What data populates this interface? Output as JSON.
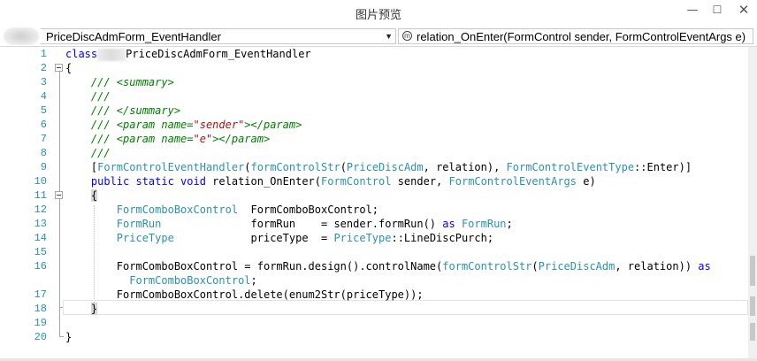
{
  "window": {
    "title": "图片预览",
    "minimize_glyph": "—",
    "maximize_glyph": "☐",
    "close_glyph": "✕"
  },
  "navbar": {
    "type_combo": {
      "value": "PriceDiscAdmForm_EventHandler",
      "arrow": "▼"
    },
    "method_combo": {
      "value": "relation_OnEnter(FormControl sender, FormControlEventArgs e)",
      "icon": "method-icon"
    }
  },
  "editor": {
    "line_numbers": [
      "1",
      "2",
      "3",
      "4",
      "5",
      "6",
      "7",
      "8",
      "9",
      "10",
      "11",
      "12",
      "13",
      "14",
      "15",
      "16",
      "",
      "17",
      "18",
      "19",
      "20"
    ],
    "lines": [
      [
        {
          "t": "kw",
          "v": "class"
        },
        {
          "t": "redacted",
          "v": ""
        },
        {
          "t": "plain",
          "v": "PriceDiscAdmForm_EventHandler"
        }
      ],
      [
        {
          "t": "plain",
          "v": "{"
        }
      ],
      [
        {
          "t": "plain",
          "v": "    "
        },
        {
          "t": "cm",
          "v": "/// <summary>"
        }
      ],
      [
        {
          "t": "plain",
          "v": "    "
        },
        {
          "t": "cm",
          "v": "///"
        }
      ],
      [
        {
          "t": "plain",
          "v": "    "
        },
        {
          "t": "cm",
          "v": "/// </summary>"
        }
      ],
      [
        {
          "t": "plain",
          "v": "    "
        },
        {
          "t": "cm",
          "v": "/// <param name="
        },
        {
          "t": "cms",
          "v": "\"sender\""
        },
        {
          "t": "cm",
          "v": "></param>"
        }
      ],
      [
        {
          "t": "plain",
          "v": "    "
        },
        {
          "t": "cm",
          "v": "/// <param name="
        },
        {
          "t": "cms",
          "v": "\"e\""
        },
        {
          "t": "cm",
          "v": "></param>"
        }
      ],
      [
        {
          "t": "plain",
          "v": "    "
        },
        {
          "t": "cm",
          "v": "///"
        }
      ],
      [
        {
          "t": "plain",
          "v": "    ["
        },
        {
          "t": "ty",
          "v": "FormControlEventHandler"
        },
        {
          "t": "plain",
          "v": "("
        },
        {
          "t": "ty",
          "v": "formControlStr"
        },
        {
          "t": "plain",
          "v": "("
        },
        {
          "t": "ty",
          "v": "PriceDiscAdm"
        },
        {
          "t": "plain",
          "v": ", relation), "
        },
        {
          "t": "ty",
          "v": "FormControlEventType"
        },
        {
          "t": "plain",
          "v": "::Enter)]"
        }
      ],
      [
        {
          "t": "plain",
          "v": "    "
        },
        {
          "t": "kw",
          "v": "public static void"
        },
        {
          "t": "plain",
          "v": " relation_OnEnter("
        },
        {
          "t": "ty",
          "v": "FormControl"
        },
        {
          "t": "plain",
          "v": " sender, "
        },
        {
          "t": "ty",
          "v": "FormControlEventArgs"
        },
        {
          "t": "plain",
          "v": " e)"
        }
      ],
      [
        {
          "t": "plain",
          "v": "    "
        },
        {
          "t": "brace",
          "v": "{"
        }
      ],
      [
        {
          "t": "plain",
          "v": "        "
        },
        {
          "t": "ty",
          "v": "FormComboBoxControl"
        },
        {
          "t": "plain",
          "v": "  FormComboBoxControl;"
        }
      ],
      [
        {
          "t": "plain",
          "v": "        "
        },
        {
          "t": "ty",
          "v": "FormRun"
        },
        {
          "t": "plain",
          "v": "              formRun    = sender.formRun() "
        },
        {
          "t": "kw",
          "v": "as"
        },
        {
          "t": "plain",
          "v": " "
        },
        {
          "t": "ty",
          "v": "FormRun"
        },
        {
          "t": "plain",
          "v": ";"
        }
      ],
      [
        {
          "t": "plain",
          "v": "        "
        },
        {
          "t": "ty",
          "v": "PriceType"
        },
        {
          "t": "plain",
          "v": "            priceType  = "
        },
        {
          "t": "ty",
          "v": "PriceType"
        },
        {
          "t": "plain",
          "v": "::LineDiscPurch;"
        }
      ],
      [
        {
          "t": "plain",
          "v": ""
        }
      ],
      [
        {
          "t": "plain",
          "v": "        FormComboBoxControl = formRun.design().controlName("
        },
        {
          "t": "ty",
          "v": "formControlStr"
        },
        {
          "t": "plain",
          "v": "("
        },
        {
          "t": "ty",
          "v": "PriceDiscAdm"
        },
        {
          "t": "plain",
          "v": ", relation)) "
        },
        {
          "t": "kw",
          "v": "as"
        }
      ],
      [
        {
          "t": "plain",
          "v": "          "
        },
        {
          "t": "ty",
          "v": "FormComboBoxControl"
        },
        {
          "t": "plain",
          "v": ";"
        }
      ],
      [
        {
          "t": "plain",
          "v": "        FormComboBoxControl.delete(enum2Str(priceType));"
        }
      ],
      [
        {
          "t": "plain",
          "v": "    "
        },
        {
          "t": "brace",
          "v": "}"
        }
      ],
      [
        {
          "t": "plain",
          "v": ""
        }
      ],
      [
        {
          "t": "plain",
          "v": "}"
        }
      ]
    ]
  }
}
